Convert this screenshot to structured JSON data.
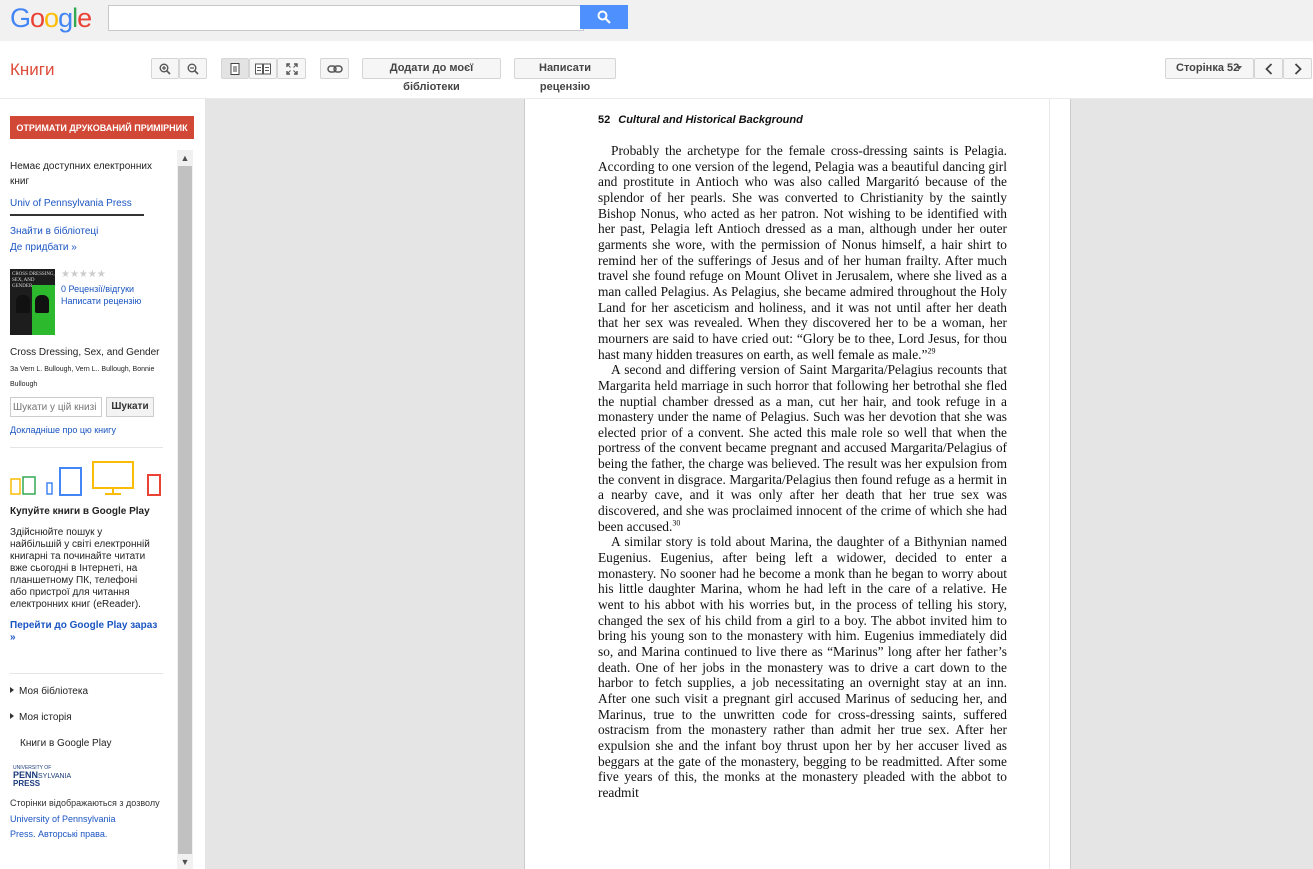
{
  "logo": {
    "letters": [
      "G",
      "o",
      "o",
      "g",
      "l",
      "e"
    ],
    "colors": [
      "#4285f4",
      "#ea4335",
      "#fbbc05",
      "#4285f4",
      "#34a853",
      "#ea4335"
    ]
  },
  "search": {
    "placeholder": "",
    "button_icon": "search-icon"
  },
  "toolbar": {
    "brand": "Книги",
    "zoom_in_icon": "zoom-in-icon",
    "zoom_out_icon": "zoom-out-icon",
    "add_to_library": "Додати до моєї бібліотеки",
    "write_review": "Написати рецензію",
    "page_selector": "Сторінка 52",
    "prev_icon": "chevron-left-icon",
    "next_icon": "chevron-right-icon"
  },
  "sidebar": {
    "print_button": "ОТРИМАТИ ДРУКОВАНИЙ ПРИМІРНИК",
    "no_ebooks": "Немає доступних електронних книг",
    "publisher_link": "Univ of Pennsylvania Press",
    "find_in_library": "Знайти в бібліотеці",
    "where_to_buy": "Де придбати »",
    "rating_stars": "★★★★★",
    "reviews_count": "0 Рецензії/відгуки",
    "write_review": "Написати рецензію",
    "book_title": "Cross Dressing, Sex, and Gender",
    "authors": "Зa Vern L. Bullough, Vern L.. Bullough, Bonnie Bullough",
    "search_in_book_placeholder": "Шукати у цій книзі",
    "search_button": "Шукати",
    "more_about_book": "Докладніше про цю книгу",
    "play_heading": "Купуйте книги в Google Play",
    "play_description": "Здійснюйте пошук у найбільшій у світі електронній книгарні та починайте читати вже сьогодні в Інтернеті, на планшетному ПК, телефоні або пристрої для читання електронних книг (eReader).",
    "play_link": "Перейти до Google Play зараз »",
    "my_library": "Моя бібліотека",
    "my_history": "Моя історія",
    "books_on_play": "Книги в Google Play",
    "publisher_logo_text": [
      "UNIVERSITY OF",
      "PENN",
      "SYLVANIA",
      "PRESS"
    ],
    "permission_text": "Сторінки відображаються з дозволу",
    "permission_link": "University of Pennsylvania Press. Авторські права."
  },
  "cover": {
    "lines": [
      "CROSS DRESSING,",
      "SEX, AND GENDER"
    ]
  },
  "page": {
    "number": "52",
    "header": "Cultural and Historical Background",
    "paragraphs": [
      "Probably the archetype for the female cross-dressing saints is Pelagia. According to one version of the legend, Pelagia was a beautiful dancing girl and prostitute in Antioch who was also called Margaritó because of the splendor of her pearls. She was converted to Christianity by the saintly Bishop Nonus, who acted as her patron. Not wishing to be identified with her past, Pelagia left Antioch dressed as a man, although under her outer garments she wore, with the permission of Nonus himself, a hair shirt to remind her of the sufferings of Jesus and of her human frailty. After much travel she found refuge on Mount Olivet in Jerusalem, where she lived as a man called Pelagius. As Pelagius, she became admired throughout the Holy Land for her asceticism and holiness, and it was not until after her death that her sex was revealed. When they discovered her to be a woman, her mourners are said to have cried out: “Glory be to thee, Lord Jesus, for thou hast many hidden treasures on earth, as well female as male.”",
      "A second and differing version of Saint Margarita/Pelagius recounts that Margarita held marriage in such horror that following her betrothal she fled the nuptial chamber dressed as a man, cut her hair, and took refuge in a monastery under the name of Pelagius. Such was her devotion that she was elected prior of a convent. She acted this male role so well that when the portress of the convent became pregnant and accused Margarita/Pelagius of being the father, the charge was believed. The result was her expulsion from the convent in disgrace. Margarita/Pelagius then found refuge as a hermit in a nearby cave, and it was only after her death that her true sex was discovered, and she was proclaimed innocent of the crime of which she had been accused.",
      "A similar story is told about Marina, the daughter of a Bithynian named Eugenius. Eugenius, after being left a widower, decided to enter a monastery. No sooner had he become a monk than he began to worry about his little daughter Marina, whom he had left in the care of a relative. He went to his abbot with his worries but, in the process of telling his story, changed the sex of his child from a girl to a boy. The abbot invited him to bring his young son to the monastery with him. Eugenius immediately did so, and Marina continued to live there as “Marinus” long after her father’s death. One of her jobs in the monastery was to drive a cart down to the harbor to fetch supplies, a job necessitating an overnight stay at an inn. After one such visit a pregnant girl accused Marinus of seducing her, and Marinus, true to the unwritten code for cross-dressing saints, suffered ostracism from the monastery rather than admit her true sex. After her expulsion she and the infant boy thrust upon her by her accuser lived as beggars at the gate of the monastery, begging to be readmitted. After some five years of this, the monks at the monastery pleaded with the abbot to readmit"
    ],
    "footnotes": [
      "29",
      "30"
    ]
  }
}
